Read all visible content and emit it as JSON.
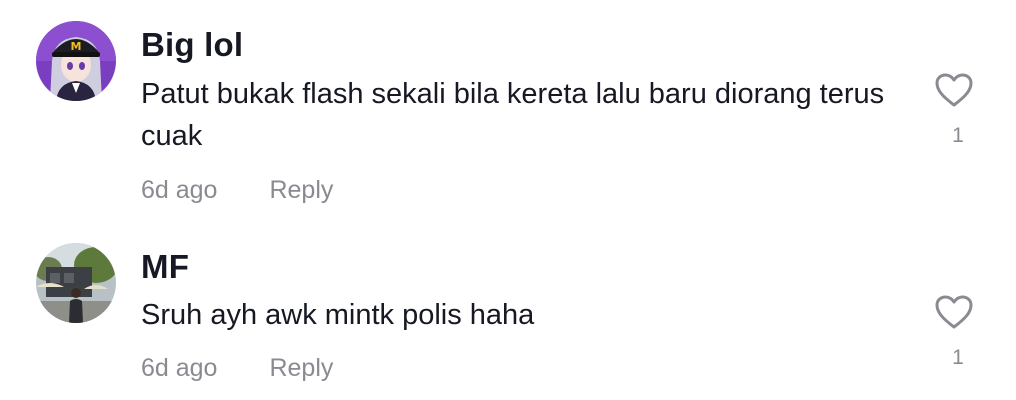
{
  "comments": [
    {
      "username": "Big lol",
      "text": "Patut bukak flash sekali bila kereta lalu baru diorang terus cuak",
      "time": "6d ago",
      "reply_label": "Reply",
      "likes": "1",
      "avatar_icon": "anime-character-avatar",
      "like_icon": "heart-outline-icon"
    },
    {
      "username": "MF",
      "text": "Sruh ayh awk mintk polis haha",
      "time": "6d ago",
      "reply_label": "Reply",
      "likes": "1",
      "avatar_icon": "photo-avatar",
      "like_icon": "heart-outline-icon"
    }
  ],
  "colors": {
    "text": "#161823",
    "muted": "#8a8b91",
    "background": "#ffffff"
  }
}
